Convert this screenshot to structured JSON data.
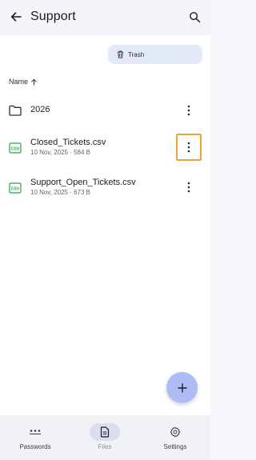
{
  "header": {
    "title": "Support",
    "back_icon": "arrow-left-icon",
    "search_icon": "search-icon"
  },
  "toolbar": {
    "trash_label": "Trash",
    "trash_icon": "trash-icon"
  },
  "sort": {
    "label": "Name",
    "direction_icon": "arrow-up-icon"
  },
  "files": [
    {
      "name": "2026",
      "meta": "",
      "type": "folder",
      "icon": "folder-icon"
    },
    {
      "name": "Closed_Tickets.csv",
      "meta": "10 Nov, 2025 · 584 B",
      "type": "csv",
      "icon": "csv-file-icon"
    },
    {
      "name": "Support_Open_Tickets.csv",
      "meta": "10 Nov, 2025 · 673 B",
      "type": "csv",
      "icon": "csv-file-icon"
    }
  ],
  "fab": {
    "icon": "plus-icon"
  },
  "bottom_nav": {
    "items": [
      {
        "label": "Passwords",
        "icon": "dots-password-icon"
      },
      {
        "label": "Files",
        "icon": "file-icon",
        "active": true
      },
      {
        "label": "Settings",
        "icon": "gear-icon"
      }
    ]
  },
  "colors": {
    "accent": "#aebcf6",
    "chip": "#e4e9f7",
    "csv_green": "#2e9e4a",
    "focus_outline": "#f0a23a"
  }
}
